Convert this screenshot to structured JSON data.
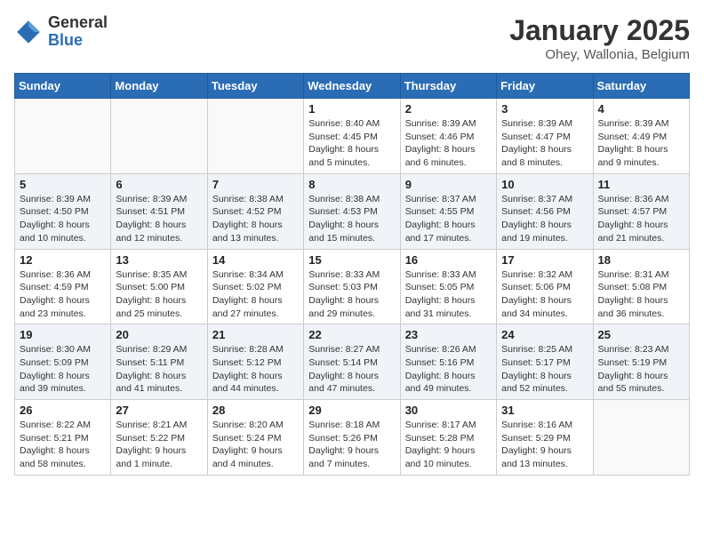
{
  "header": {
    "logo_general": "General",
    "logo_blue": "Blue",
    "month_title": "January 2025",
    "location": "Ohey, Wallonia, Belgium"
  },
  "days_of_week": [
    "Sunday",
    "Monday",
    "Tuesday",
    "Wednesday",
    "Thursday",
    "Friday",
    "Saturday"
  ],
  "weeks": [
    [
      {
        "day": "",
        "info": ""
      },
      {
        "day": "",
        "info": ""
      },
      {
        "day": "",
        "info": ""
      },
      {
        "day": "1",
        "info": "Sunrise: 8:40 AM\nSunset: 4:45 PM\nDaylight: 8 hours\nand 5 minutes."
      },
      {
        "day": "2",
        "info": "Sunrise: 8:39 AM\nSunset: 4:46 PM\nDaylight: 8 hours\nand 6 minutes."
      },
      {
        "day": "3",
        "info": "Sunrise: 8:39 AM\nSunset: 4:47 PM\nDaylight: 8 hours\nand 8 minutes."
      },
      {
        "day": "4",
        "info": "Sunrise: 8:39 AM\nSunset: 4:49 PM\nDaylight: 8 hours\nand 9 minutes."
      }
    ],
    [
      {
        "day": "5",
        "info": "Sunrise: 8:39 AM\nSunset: 4:50 PM\nDaylight: 8 hours\nand 10 minutes."
      },
      {
        "day": "6",
        "info": "Sunrise: 8:39 AM\nSunset: 4:51 PM\nDaylight: 8 hours\nand 12 minutes."
      },
      {
        "day": "7",
        "info": "Sunrise: 8:38 AM\nSunset: 4:52 PM\nDaylight: 8 hours\nand 13 minutes."
      },
      {
        "day": "8",
        "info": "Sunrise: 8:38 AM\nSunset: 4:53 PM\nDaylight: 8 hours\nand 15 minutes."
      },
      {
        "day": "9",
        "info": "Sunrise: 8:37 AM\nSunset: 4:55 PM\nDaylight: 8 hours\nand 17 minutes."
      },
      {
        "day": "10",
        "info": "Sunrise: 8:37 AM\nSunset: 4:56 PM\nDaylight: 8 hours\nand 19 minutes."
      },
      {
        "day": "11",
        "info": "Sunrise: 8:36 AM\nSunset: 4:57 PM\nDaylight: 8 hours\nand 21 minutes."
      }
    ],
    [
      {
        "day": "12",
        "info": "Sunrise: 8:36 AM\nSunset: 4:59 PM\nDaylight: 8 hours\nand 23 minutes."
      },
      {
        "day": "13",
        "info": "Sunrise: 8:35 AM\nSunset: 5:00 PM\nDaylight: 8 hours\nand 25 minutes."
      },
      {
        "day": "14",
        "info": "Sunrise: 8:34 AM\nSunset: 5:02 PM\nDaylight: 8 hours\nand 27 minutes."
      },
      {
        "day": "15",
        "info": "Sunrise: 8:33 AM\nSunset: 5:03 PM\nDaylight: 8 hours\nand 29 minutes."
      },
      {
        "day": "16",
        "info": "Sunrise: 8:33 AM\nSunset: 5:05 PM\nDaylight: 8 hours\nand 31 minutes."
      },
      {
        "day": "17",
        "info": "Sunrise: 8:32 AM\nSunset: 5:06 PM\nDaylight: 8 hours\nand 34 minutes."
      },
      {
        "day": "18",
        "info": "Sunrise: 8:31 AM\nSunset: 5:08 PM\nDaylight: 8 hours\nand 36 minutes."
      }
    ],
    [
      {
        "day": "19",
        "info": "Sunrise: 8:30 AM\nSunset: 5:09 PM\nDaylight: 8 hours\nand 39 minutes."
      },
      {
        "day": "20",
        "info": "Sunrise: 8:29 AM\nSunset: 5:11 PM\nDaylight: 8 hours\nand 41 minutes."
      },
      {
        "day": "21",
        "info": "Sunrise: 8:28 AM\nSunset: 5:12 PM\nDaylight: 8 hours\nand 44 minutes."
      },
      {
        "day": "22",
        "info": "Sunrise: 8:27 AM\nSunset: 5:14 PM\nDaylight: 8 hours\nand 47 minutes."
      },
      {
        "day": "23",
        "info": "Sunrise: 8:26 AM\nSunset: 5:16 PM\nDaylight: 8 hours\nand 49 minutes."
      },
      {
        "day": "24",
        "info": "Sunrise: 8:25 AM\nSunset: 5:17 PM\nDaylight: 8 hours\nand 52 minutes."
      },
      {
        "day": "25",
        "info": "Sunrise: 8:23 AM\nSunset: 5:19 PM\nDaylight: 8 hours\nand 55 minutes."
      }
    ],
    [
      {
        "day": "26",
        "info": "Sunrise: 8:22 AM\nSunset: 5:21 PM\nDaylight: 8 hours\nand 58 minutes."
      },
      {
        "day": "27",
        "info": "Sunrise: 8:21 AM\nSunset: 5:22 PM\nDaylight: 9 hours\nand 1 minute."
      },
      {
        "day": "28",
        "info": "Sunrise: 8:20 AM\nSunset: 5:24 PM\nDaylight: 9 hours\nand 4 minutes."
      },
      {
        "day": "29",
        "info": "Sunrise: 8:18 AM\nSunset: 5:26 PM\nDaylight: 9 hours\nand 7 minutes."
      },
      {
        "day": "30",
        "info": "Sunrise: 8:17 AM\nSunset: 5:28 PM\nDaylight: 9 hours\nand 10 minutes."
      },
      {
        "day": "31",
        "info": "Sunrise: 8:16 AM\nSunset: 5:29 PM\nDaylight: 9 hours\nand 13 minutes."
      },
      {
        "day": "",
        "info": ""
      }
    ]
  ]
}
